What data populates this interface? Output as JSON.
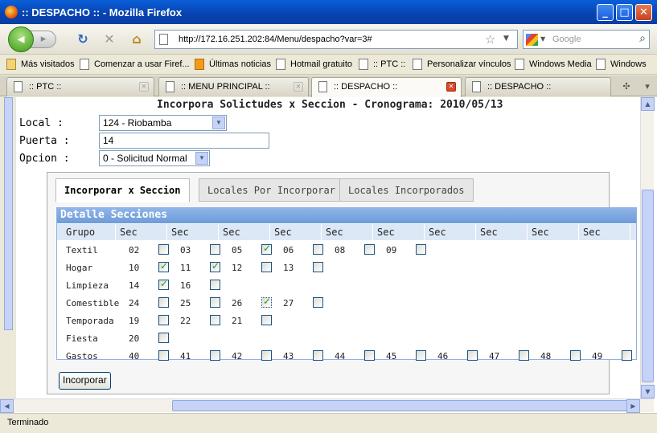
{
  "window": {
    "title": ":: DESPACHO :: - Mozilla Firefox",
    "buttons": {
      "minimize": "_",
      "maximize": "□",
      "close": "✕"
    }
  },
  "nav": {
    "url": "http://172.16.251.202:84/Menu/despacho?var=3#",
    "search_placeholder": "Google"
  },
  "bookmarks": [
    {
      "label": "Más visitados"
    },
    {
      "label": "Comenzar a usar Firef..."
    },
    {
      "label": "Últimas noticias"
    },
    {
      "label": "Hotmail gratuito"
    },
    {
      "label": ":: PTC ::"
    },
    {
      "label": "Personalizar vínculos"
    },
    {
      "label": "Windows Media"
    },
    {
      "label": "Windows"
    }
  ],
  "tabs": [
    {
      "label": ":: PTC ::",
      "active": false
    },
    {
      "label": ":: MENU PRINCIPAL ::",
      "active": false
    },
    {
      "label": ":: DESPACHO ::",
      "active": true
    },
    {
      "label": ":: DESPACHO ::",
      "active": false
    }
  ],
  "page": {
    "title": "Incorpora Solictudes x Seccion - Cronograma: 2010/05/13",
    "form": {
      "local_label": "Local :",
      "local_value": "124 - Riobamba",
      "puerta_label": "Puerta :",
      "puerta_value": "14",
      "opcion_label": "Opcion :",
      "opcion_value": "0 - Solicitud Normal"
    },
    "panel_tabs": [
      {
        "label": "Incorporar x Seccion",
        "active": true
      },
      {
        "label": "Locales Por Incorporar",
        "active": false
      },
      {
        "label": "Locales Incorporados",
        "active": false
      }
    ],
    "detail": {
      "header": "Detalle Secciones",
      "col_grupo": "Grupo",
      "col_sec": "Sec",
      "rows": [
        {
          "grupo": "Textil",
          "secs": [
            {
              "n": "02",
              "checked": false
            },
            {
              "n": "03",
              "checked": false
            },
            {
              "n": "05",
              "checked": true
            },
            {
              "n": "06",
              "checked": false
            },
            {
              "n": "08",
              "checked": false
            },
            {
              "n": "09",
              "checked": false
            }
          ]
        },
        {
          "grupo": "Hogar",
          "secs": [
            {
              "n": "10",
              "checked": true
            },
            {
              "n": "11",
              "checked": true
            },
            {
              "n": "12",
              "checked": false
            },
            {
              "n": "13",
              "checked": false
            }
          ]
        },
        {
          "grupo": "Limpieza",
          "secs": [
            {
              "n": "14",
              "checked": true
            },
            {
              "n": "16",
              "checked": false
            }
          ]
        },
        {
          "grupo": "Comestible",
          "secs": [
            {
              "n": "24",
              "checked": false
            },
            {
              "n": "25",
              "checked": false
            },
            {
              "n": "26",
              "checked": true,
              "dotted": true
            },
            {
              "n": "27",
              "checked": false
            }
          ]
        },
        {
          "grupo": "Temporada",
          "secs": [
            {
              "n": "19",
              "checked": false
            },
            {
              "n": "22",
              "checked": false
            },
            {
              "n": "21",
              "checked": false
            }
          ]
        },
        {
          "grupo": "Fiesta",
          "secs": [
            {
              "n": "20",
              "checked": false
            }
          ]
        },
        {
          "grupo": "Gastos",
          "secs": [
            {
              "n": "40",
              "checked": false
            },
            {
              "n": "41",
              "checked": false
            },
            {
              "n": "42",
              "checked": false
            },
            {
              "n": "43",
              "checked": false
            },
            {
              "n": "44",
              "checked": false
            },
            {
              "n": "45",
              "checked": false
            },
            {
              "n": "46",
              "checked": false
            },
            {
              "n": "47",
              "checked": false
            },
            {
              "n": "48",
              "checked": false
            },
            {
              "n": "49",
              "checked": false
            }
          ]
        }
      ]
    },
    "submit_label": "Incorporar"
  },
  "status": {
    "text": "Terminado"
  }
}
